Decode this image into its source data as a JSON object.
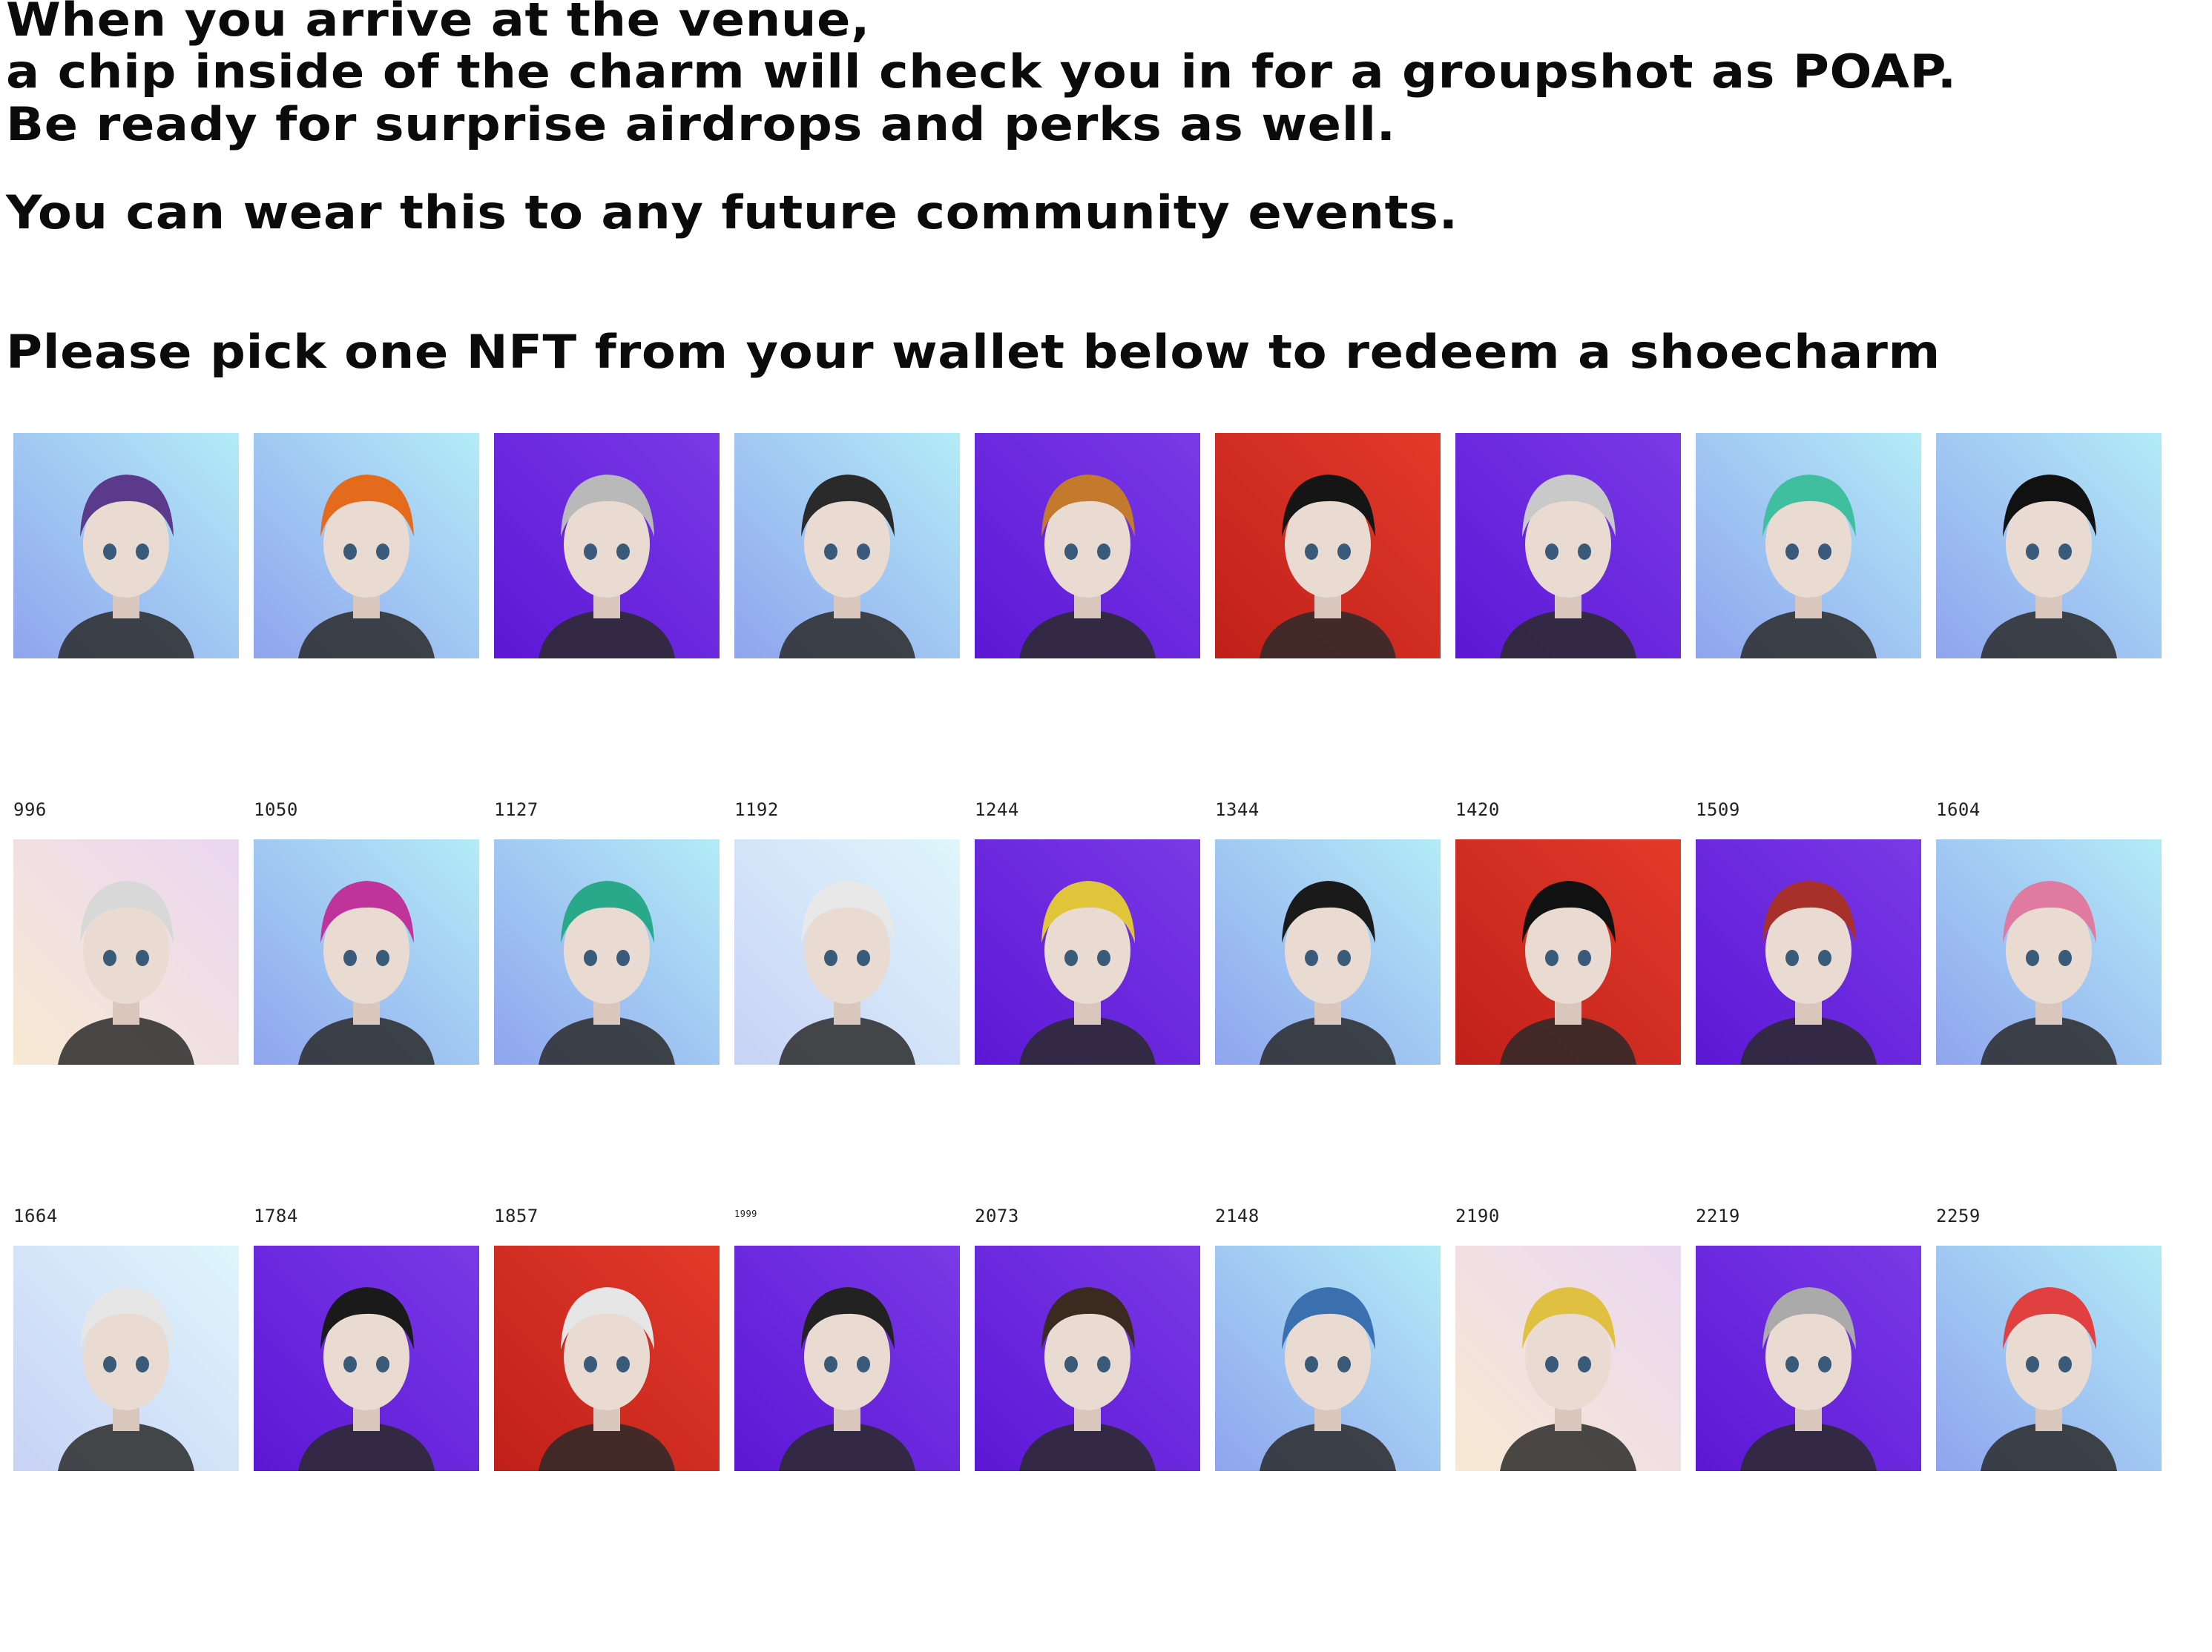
{
  "intro": {
    "line1": "When you arrive at the venue,",
    "line2": "a chip inside of the charm will check you in for a groupshot as POAP.",
    "line3": "Be ready for surprise airdrops and perks as well.",
    "line4": "You can wear this to any future community events.",
    "prompt": "Please pick one NFT from your wallet below to redeem a shoecharm"
  },
  "rows": [
    {
      "tiles": [
        {
          "id": "996",
          "bg": "light",
          "hair": "#5b3a8c"
        },
        {
          "id": "1050",
          "bg": "light",
          "hair": "#e46a1c"
        },
        {
          "id": "1127",
          "bg": "purple",
          "hair": "#b9b9b9"
        },
        {
          "id": "1192",
          "bg": "light",
          "hair": "#2a2a2a"
        },
        {
          "id": "1244",
          "bg": "purple",
          "hair": "#c47a2c"
        },
        {
          "id": "1344",
          "bg": "red",
          "hair": "#151515"
        },
        {
          "id": "1420",
          "bg": "purple",
          "hair": "#c9c9c9"
        },
        {
          "id": "1509",
          "bg": "light",
          "hair": "#3fbf9f"
        },
        {
          "id": "1604",
          "bg": "light",
          "hair": "#111111"
        }
      ]
    },
    {
      "tiles": [
        {
          "id": "1664",
          "bg": "cream",
          "hair": "#d8d8d8"
        },
        {
          "id": "1784",
          "bg": "light",
          "hair": "#c0339b"
        },
        {
          "id": "1857",
          "bg": "light",
          "hair": "#2aa98a"
        },
        {
          "id": "1999",
          "bg": "pale",
          "hair": "#e8e8e8"
        },
        {
          "id": "2073",
          "bg": "purple",
          "hair": "#e0c53a"
        },
        {
          "id": "2148",
          "bg": "light",
          "hair": "#1a1a1a"
        },
        {
          "id": "2190",
          "bg": "red",
          "hair": "#111111"
        },
        {
          "id": "2219",
          "bg": "purple",
          "hair": "#a8302a"
        },
        {
          "id": "2259",
          "bg": "light",
          "hair": "#e07aa0"
        }
      ]
    },
    {
      "tiles": [
        {
          "id": "",
          "bg": "pale",
          "hair": "#e6e6e6"
        },
        {
          "id": "",
          "bg": "purple",
          "hair": "#1a1a1a"
        },
        {
          "id": "",
          "bg": "red",
          "hair": "#e6e6e6"
        },
        {
          "id": "",
          "bg": "purple",
          "hair": "#222222"
        },
        {
          "id": "",
          "bg": "purple",
          "hair": "#3a2a20"
        },
        {
          "id": "",
          "bg": "light",
          "hair": "#3a6fb0"
        },
        {
          "id": "",
          "bg": "cream",
          "hair": "#e0c040"
        },
        {
          "id": "",
          "bg": "purple",
          "hair": "#aaaaaa"
        },
        {
          "id": "",
          "bg": "light",
          "hair": "#e04040"
        }
      ]
    }
  ],
  "colors": {
    "light_a": "#8fa4ee",
    "light_b": "#b3ecf7",
    "purple_a": "#5c17d6",
    "purple_b": "#7a3ae6",
    "red_a": "#c0201a",
    "red_b": "#e23a2a",
    "cream_a": "#f7e9d2",
    "cream_b": "#ead7f2",
    "pale_a": "#c8d2f6",
    "pale_b": "#dff6fb"
  }
}
